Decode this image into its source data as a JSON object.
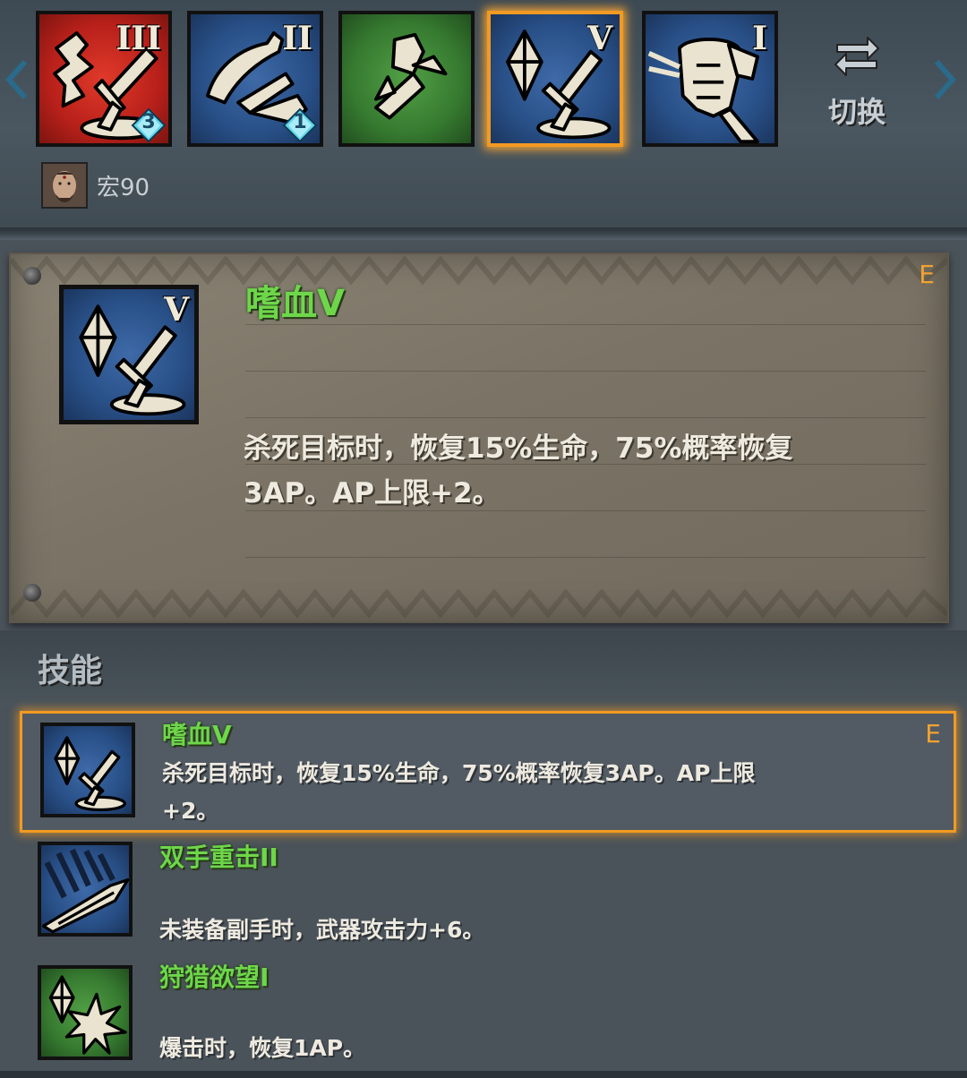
{
  "topbar": {
    "slots": [
      {
        "roman": "III",
        "badge": "3",
        "color": "red",
        "icon": "bloodlust-sword-icon"
      },
      {
        "roman": "II",
        "badge": "1",
        "color": "blue",
        "icon": "leap-strike-icon"
      },
      {
        "roman": "",
        "badge": "",
        "color": "green",
        "icon": "dash-gem-icon"
      },
      {
        "roman": "V",
        "badge": "",
        "color": "blue",
        "icon": "gem-sword-icon",
        "selected": true
      },
      {
        "roman": "I",
        "badge": "",
        "color": "blue",
        "icon": "armor-icon"
      }
    ],
    "switch_label": "切换",
    "owner_name": "宏90"
  },
  "detail": {
    "title": "嗜血V",
    "roman": "V",
    "grade": "E",
    "description": "杀死目标时，恢复15%生命，75%概率恢复3AP。AP上限+2。"
  },
  "skills_section": {
    "title": "技能",
    "items": [
      {
        "name": "嗜血V",
        "grade": "E",
        "description": "杀死目标时，恢复15%生命，75%概率恢复3AP。AP上限+2。",
        "icon": "gem-sword-icon",
        "selected": true
      },
      {
        "name": "双手重击II",
        "grade": "",
        "description": "未装备副手时，武器攻击力+6。",
        "icon": "heavy-strike-icon",
        "selected": false
      },
      {
        "name": "狩猎欲望I",
        "grade": "",
        "description": "爆击时，恢复1AP。",
        "icon": "gem-burst-icon",
        "selected": false
      }
    ]
  },
  "colors": {
    "skill_name_green": "#6ed64a",
    "selection_orange": "#f29a22",
    "grade_orange": "#f2a233",
    "badge_cyan": "#5fd6ec"
  }
}
